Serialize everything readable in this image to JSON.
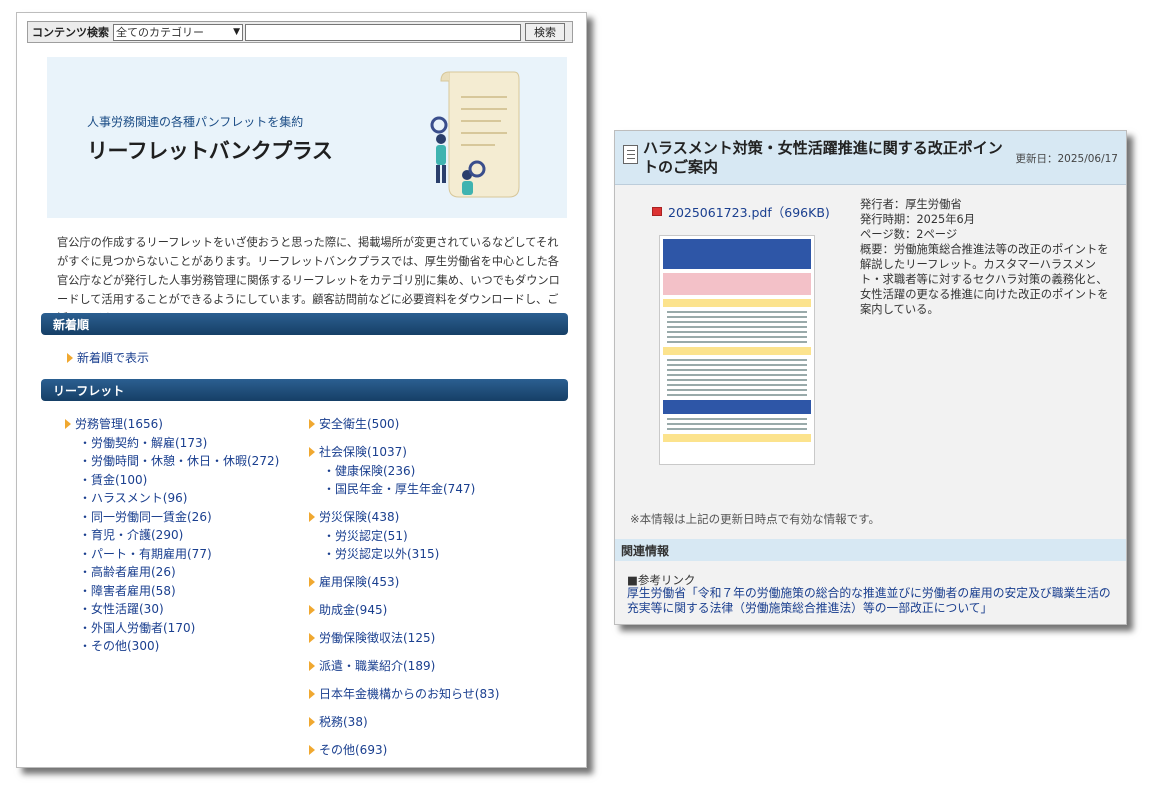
{
  "search": {
    "label": "コンテンツ検索",
    "category_selected": "全てのカテゴリー",
    "input_value": "",
    "button": "検索"
  },
  "hero": {
    "subtitle": "人事労務関連の各種パンフレットを集約",
    "title": "リーフレットバンクプラス"
  },
  "intro": "官公庁の作成するリーフレットをいざ使おうと思った際に、掲載場所が変更されているなどしてそれがすぐに見つからないことがあります。リーフレットバンクプラスでは、厚生労働省を中心とした各官公庁などが発行した人事労務管理に関係するリーフレットをカテゴリ別に集め、いつでもダウンロードして活用することができるようにしています。顧客訪問前などに必要資料をダウンロードし、ご活用ください。",
  "sections": {
    "new": "新着順",
    "new_link": "新着順で表示",
    "leaflet": "リーフレット"
  },
  "categories_col1": {
    "main": "労務管理(1656)",
    "subs": [
      "・労働契約・解雇(173)",
      "・労働時間・休憩・休日・休暇(272)",
      "・賃金(100)",
      "・ハラスメント(96)",
      "・同一労働同一賃金(26)",
      "・育児・介護(290)",
      "・パート・有期雇用(77)",
      "・高齢者雇用(26)",
      "・障害者雇用(58)",
      "・女性活躍(30)",
      "・外国人労働者(170)",
      "・その他(300)"
    ]
  },
  "categories_col2": [
    {
      "main": "安全衛生(500)",
      "subs": []
    },
    {
      "main": "社会保険(1037)",
      "subs": [
        "・健康保険(236)",
        "・国民年金・厚生年金(747)"
      ]
    },
    {
      "main": "労災保険(438)",
      "subs": [
        "・労災認定(51)",
        "・労災認定以外(315)"
      ]
    },
    {
      "main": "雇用保険(453)",
      "subs": []
    },
    {
      "main": "助成金(945)",
      "subs": []
    },
    {
      "main": "労働保険徴収法(125)",
      "subs": []
    },
    {
      "main": "派遣・職業紹介(189)",
      "subs": []
    },
    {
      "main": "日本年金機構からのお知らせ(83)",
      "subs": []
    },
    {
      "main": "税務(38)",
      "subs": []
    },
    {
      "main": "その他(693)",
      "subs": []
    }
  ],
  "detail": {
    "title": "ハラスメント対策・女性活躍推進に関する改正ポイントのご案内",
    "updated": "更新日：2025/06/17",
    "pdf_link": "2025061723.pdf（696KB)",
    "publisher": "発行者：厚生労働省",
    "published": "発行時期：2025年6月",
    "pages": "ページ数：2ページ",
    "summary": "概要：労働施策総合推進法等の改正のポイントを解説したリーフレット。カスタマーハラスメント・求職者等に対するセクハラ対策の義務化と、女性活躍の更なる推進に向けた改正のポイントを案内している。",
    "note": "※本情報は上記の更新日時点で有効な情報です。",
    "related_title": "関連情報",
    "ref_label": "■参考リンク",
    "ref_link": "厚生労働省「令和７年の労働施策の総合的な推進並びに労働者の雇用の安定及び職業生活の充実等に関する法律（労働施策総合推進法）等の一部改正について」"
  },
  "colors": {
    "accent_navy": "#1f4e79",
    "link": "#1a3f8f",
    "arrow": "#f0a830",
    "header_light": "#d7e8f3"
  }
}
